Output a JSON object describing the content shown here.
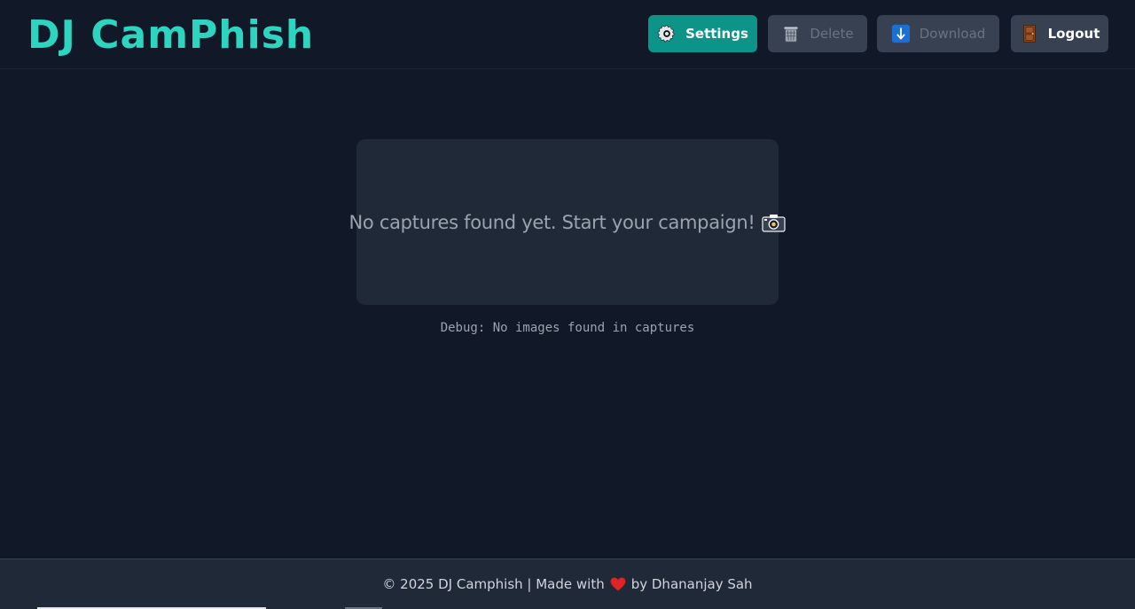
{
  "header": {
    "logo": "DJ CamPhish",
    "buttons": {
      "settings": {
        "label": "Settings",
        "icon": "gear-icon"
      },
      "delete": {
        "label": "Delete",
        "icon": "trash-icon"
      },
      "download": {
        "label": "Download",
        "icon": "download-icon"
      },
      "logout": {
        "label": "Logout",
        "icon": "door-icon"
      }
    }
  },
  "main": {
    "empty_message": "No captures found yet. Start your campaign!",
    "empty_icon": "camera-icon",
    "debug_text": "Debug: No images found in captures"
  },
  "footer": {
    "text_before": "© 2025 DJ Camphish | Made with",
    "heart_icon": "heart-icon",
    "text_after": "by Dhananjay Sah"
  },
  "colors": {
    "background": "#111827",
    "accent": "#2dd4bf",
    "settings_button": "#0d9488",
    "card": "#1f2937"
  }
}
